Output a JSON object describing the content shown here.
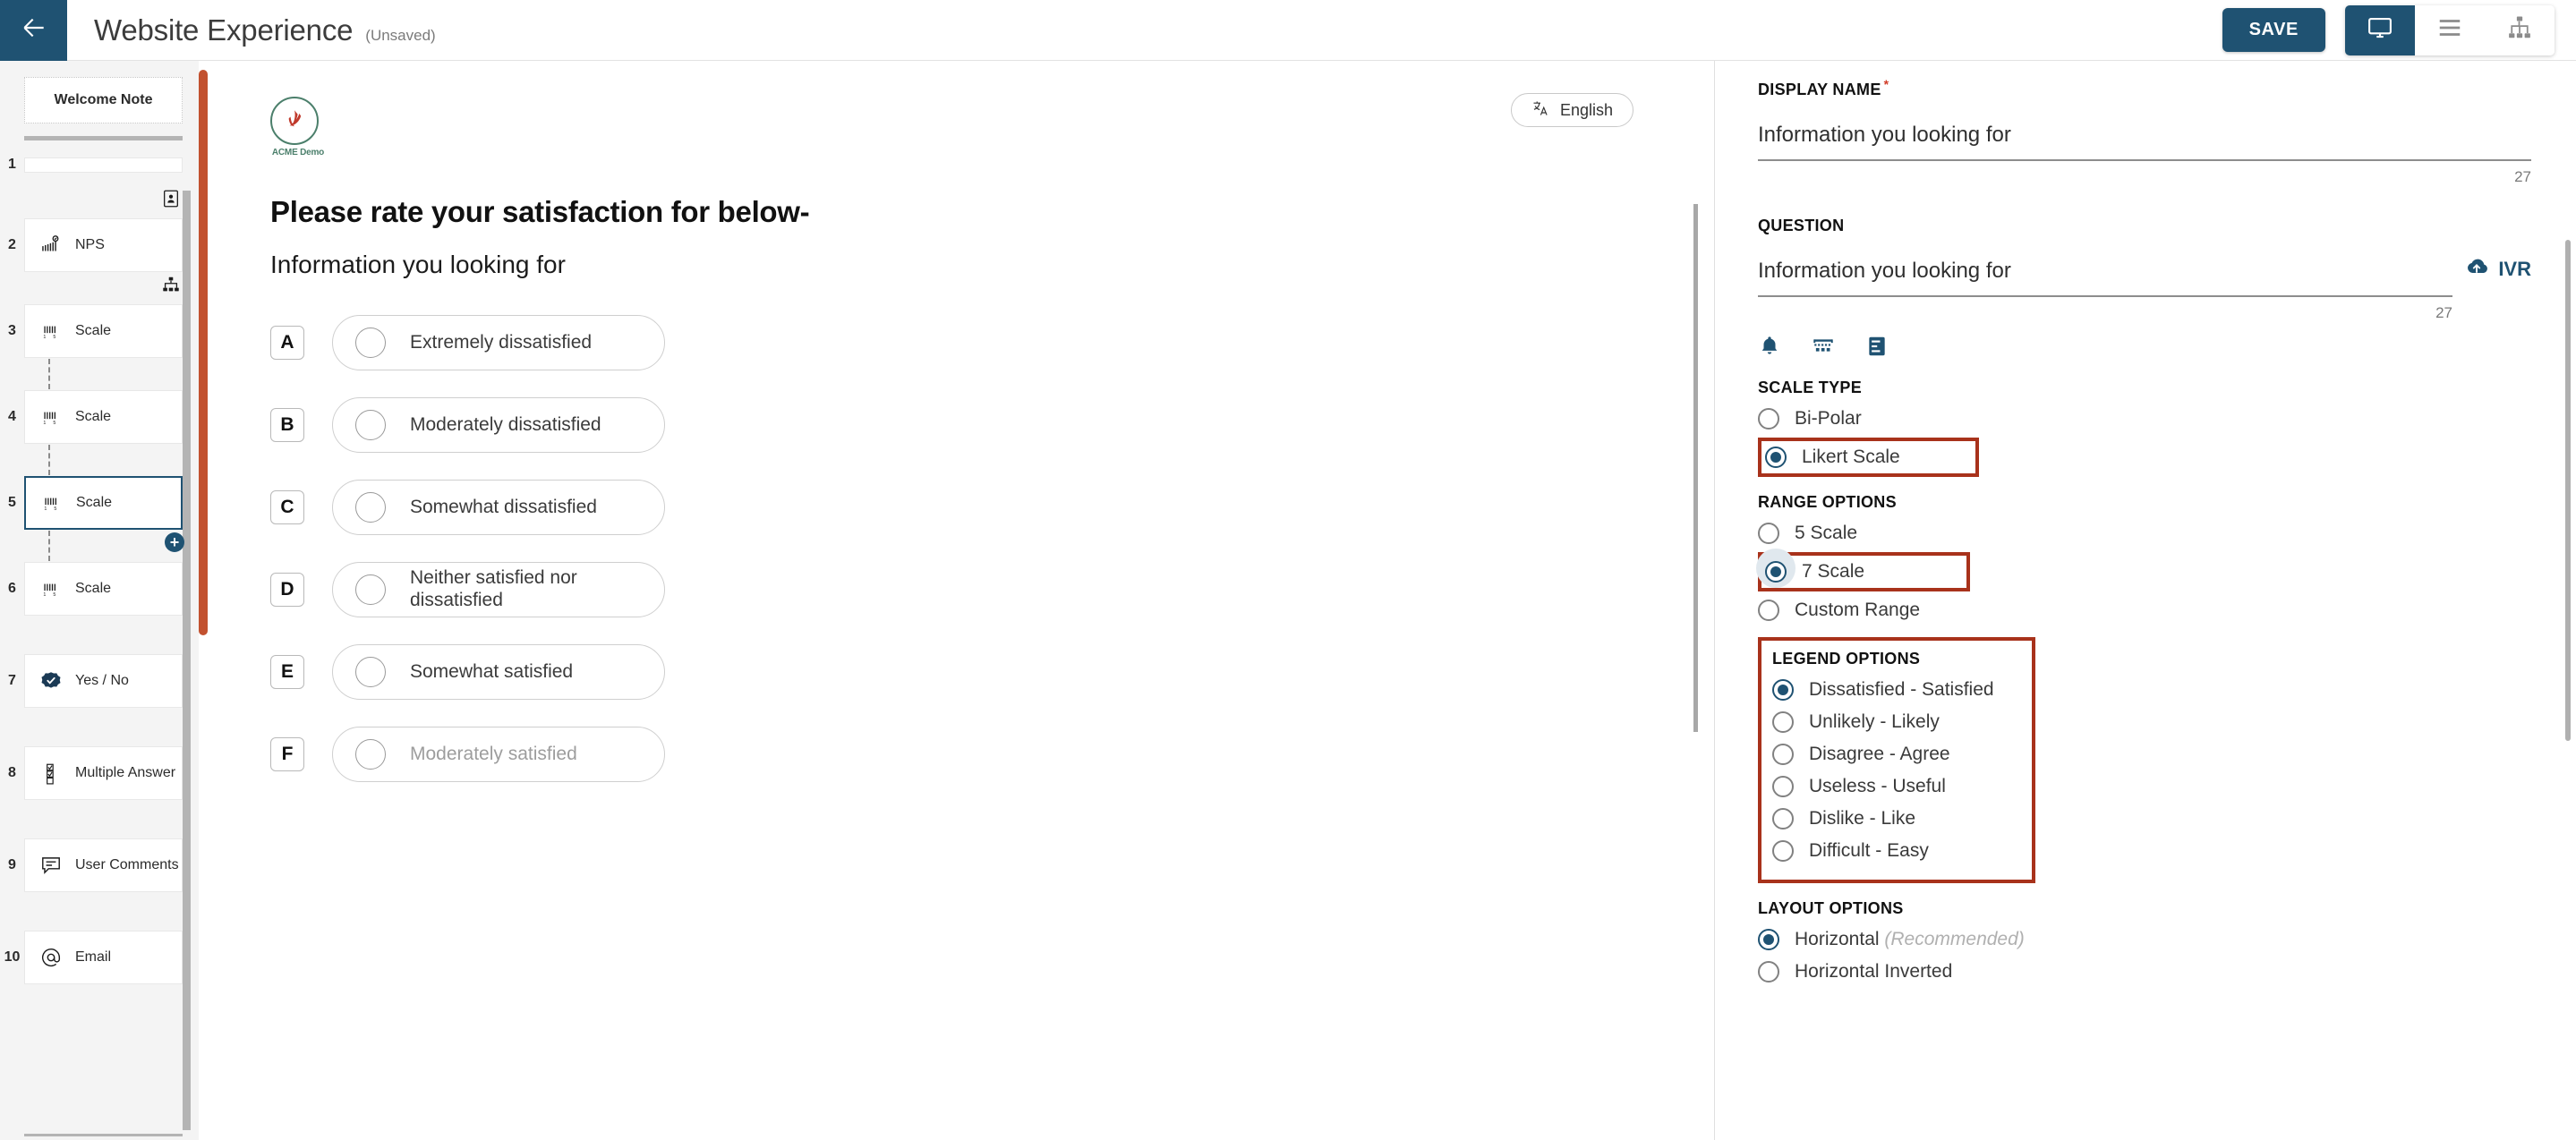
{
  "header": {
    "back_icon": "arrow-left-icon",
    "title": "Website Experience",
    "status": "(Unsaved)",
    "save_label": "SAVE",
    "views": [
      {
        "name": "desktop-preview",
        "icon": "monitor-icon",
        "active": true
      },
      {
        "name": "list-view",
        "icon": "hamburger-icon",
        "active": false
      },
      {
        "name": "flow-view",
        "icon": "sitemap-icon",
        "active": false
      }
    ]
  },
  "sidebar": {
    "welcome_note": "Welcome Note",
    "items": [
      {
        "num": "1",
        "label": "",
        "icon": "bar-placeholder",
        "type": "bar"
      },
      {
        "num": "2",
        "label": "NPS",
        "icon": "nps-icon",
        "type": "card"
      },
      {
        "num": "3",
        "label": "Scale",
        "icon": "scale-icon",
        "type": "card"
      },
      {
        "num": "4",
        "label": "Scale",
        "icon": "scale-icon",
        "type": "card"
      },
      {
        "num": "5",
        "label": "Scale",
        "icon": "scale-icon",
        "type": "card",
        "selected": true
      },
      {
        "num": "6",
        "label": "Scale",
        "icon": "scale-icon",
        "type": "card"
      },
      {
        "num": "7",
        "label": "Yes / No",
        "icon": "yesno-icon",
        "type": "card"
      },
      {
        "num": "8",
        "label": "Multiple Answer",
        "icon": "checklist-icon",
        "type": "card"
      },
      {
        "num": "9",
        "label": "User Comments",
        "icon": "comment-icon",
        "type": "card"
      },
      {
        "num": "10",
        "label": "Email",
        "icon": "at-icon",
        "type": "card"
      }
    ]
  },
  "preview": {
    "logo_name": "ACME Demo",
    "language": "English",
    "language_icon": "translate-icon",
    "question_title": "Please rate your satisfaction for below-",
    "question_subtitle": "Information you looking for",
    "options": [
      {
        "key": "A",
        "text": "Extremely dissatisfied"
      },
      {
        "key": "B",
        "text": "Moderately dissatisfied"
      },
      {
        "key": "C",
        "text": "Somewhat dissatisfied"
      },
      {
        "key": "D",
        "text": "Neither satisfied nor dissatisfied"
      },
      {
        "key": "E",
        "text": "Somewhat satisfied"
      },
      {
        "key": "F",
        "text": "Moderately satisfied"
      }
    ]
  },
  "panel": {
    "display_name_label": "DISPLAY NAME",
    "display_name_value": "Information you looking for",
    "display_name_count": "27",
    "question_label": "QUESTION",
    "question_value": "Information you looking for",
    "question_count": "27",
    "ivr_label": "IVR",
    "ivr_icon": "cloud-upload-icon",
    "tool_icons": [
      "bell-icon",
      "keypad-icon",
      "form-icon"
    ],
    "scale_type_label": "SCALE TYPE",
    "scale_type_options": [
      {
        "label": "Bi-Polar",
        "checked": false,
        "highlighted": false
      },
      {
        "label": "Likert Scale",
        "checked": true,
        "highlighted": true
      }
    ],
    "range_options_label": "RANGE OPTIONS",
    "range_options": [
      {
        "label": "5 Scale",
        "checked": false,
        "highlighted": false
      },
      {
        "label": "7 Scale",
        "checked": true,
        "highlighted": true,
        "halo": true
      },
      {
        "label": "Custom Range",
        "checked": false,
        "highlighted": false
      }
    ],
    "legend_options_label": "LEGEND OPTIONS",
    "legend_options": [
      {
        "label": "Dissatisfied - Satisfied",
        "checked": true
      },
      {
        "label": "Unlikely - Likely",
        "checked": false
      },
      {
        "label": "Disagree - Agree",
        "checked": false
      },
      {
        "label": "Useless - Useful",
        "checked": false
      },
      {
        "label": "Dislike - Like",
        "checked": false
      },
      {
        "label": "Difficult - Easy",
        "checked": false
      }
    ],
    "layout_options_label": "LAYOUT OPTIONS",
    "layout_options": [
      {
        "label": "Horizontal",
        "note": "(Recommended)",
        "checked": true
      },
      {
        "label": "Horizontal Inverted",
        "note": "",
        "checked": false
      }
    ]
  },
  "colors": {
    "brand_blue": "#1f5272",
    "highlight_red": "#a8321b",
    "scrollbar_orange": "#c2512f",
    "logo_green": "#4b7f6b",
    "logo_red": "#c0392b"
  }
}
